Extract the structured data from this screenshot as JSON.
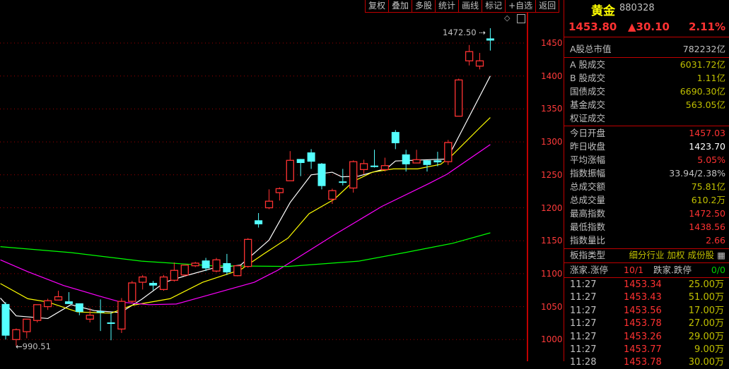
{
  "toolbar": {
    "buttons": [
      "复权",
      "叠加",
      "多股",
      "统计",
      "画线",
      "标记",
      "+自选",
      "返回"
    ]
  },
  "header": {
    "name": "黄金",
    "code": "880328",
    "price": "1453.80",
    "change": "▲30.10",
    "change_pct": "2.11%"
  },
  "market": {
    "label": "A股总市值",
    "value": "782232亿"
  },
  "turnover": [
    {
      "label": "A 股成交",
      "value": "6031.72亿"
    },
    {
      "label": "B 股成交",
      "value": "1.11亿"
    },
    {
      "label": "国债成交",
      "value": "6690.30亿"
    },
    {
      "label": "基金成交",
      "value": "563.05亿"
    },
    {
      "label": "权证成交",
      "value": ""
    }
  ],
  "stats": [
    {
      "label": "今日开盘",
      "value": "1457.03",
      "color": "red"
    },
    {
      "label": "昨日收盘",
      "value": "1423.70",
      "color": "wht"
    },
    {
      "label": "平均涨幅",
      "value": "5.05%",
      "color": "red"
    },
    {
      "label": "指数振幅",
      "value": "33.94/2.38%",
      "color": "gry"
    },
    {
      "label": "总成交额",
      "value": "75.81亿",
      "color": "yel"
    },
    {
      "label": "总成交量",
      "value": "610.2万",
      "color": "yel"
    },
    {
      "label": "最高指数",
      "value": "1472.50",
      "color": "red"
    },
    {
      "label": "最低指数",
      "value": "1438.56",
      "color": "red"
    },
    {
      "label": "指数量比",
      "value": "2.66",
      "color": "red"
    }
  ],
  "board_type": {
    "label": "板指类型",
    "value": "细分行业 加权 成份股"
  },
  "updown": {
    "up_label": "涨家.涨停",
    "up_value": "10/1",
    "down_label": "跌家.跌停",
    "down_value": "0/0"
  },
  "ticks": [
    {
      "time": "11:27",
      "price": "1453.34",
      "vol": "25.00万"
    },
    {
      "time": "11:27",
      "price": "1453.43",
      "vol": "51.00万"
    },
    {
      "time": "11:27",
      "price": "1453.56",
      "vol": "17.00万"
    },
    {
      "time": "11:27",
      "price": "1453.78",
      "vol": "27.00万"
    },
    {
      "time": "11:27",
      "price": "1453.26",
      "vol": "29.00万"
    },
    {
      "time": "11:27",
      "price": "1453.77",
      "vol": "9.00万"
    },
    {
      "time": "11:28",
      "price": "1453.78",
      "vol": "30.00万"
    }
  ],
  "axis_labels": [
    "1450",
    "1400",
    "1350",
    "1300",
    "1250",
    "1200",
    "1150",
    "1100",
    "1050",
    "1000"
  ],
  "annotations": {
    "high": "1472.50",
    "low": "990.51"
  },
  "colors": {
    "up": "#ff3232",
    "down": "#54ffff",
    "ma5": "#ffffff",
    "ma10": "#ffff00",
    "ma20": "#ff00ff",
    "ma60": "#00ff00",
    "grid": "#a00000"
  },
  "chart_data": {
    "type": "candlestick",
    "ylim": [
      1000,
      1450
    ],
    "y_ticks": [
      1000,
      1050,
      1100,
      1150,
      1200,
      1250,
      1300,
      1350,
      1400,
      1450
    ],
    "ohlc": [
      [
        1054,
        1057,
        1000,
        1006
      ],
      [
        1000,
        1017,
        990.51,
        1015
      ],
      [
        1012,
        1031,
        1002,
        1031
      ],
      [
        1029,
        1053,
        1026,
        1053
      ],
      [
        1050,
        1062,
        1045,
        1059
      ],
      [
        1060,
        1074,
        1060,
        1065
      ],
      [
        1058,
        1072,
        1054,
        1054
      ],
      [
        1055,
        1055,
        1037,
        1042
      ],
      [
        1031,
        1048,
        1026,
        1037
      ],
      [
        1043,
        1061,
        1013,
        1042
      ],
      [
        1026,
        1041,
        999,
        1025
      ],
      [
        1016,
        1063,
        1010,
        1058
      ],
      [
        1058,
        1089,
        1055,
        1086
      ],
      [
        1087,
        1098,
        1076,
        1095
      ],
      [
        1086,
        1089,
        1075,
        1082
      ],
      [
        1076,
        1098,
        1074,
        1095
      ],
      [
        1090,
        1117,
        1088,
        1105
      ],
      [
        1098,
        1113,
        1096,
        1113
      ],
      [
        1112,
        1118,
        1110,
        1116
      ],
      [
        1120,
        1124,
        1104,
        1108
      ],
      [
        1104,
        1124,
        1102,
        1121
      ],
      [
        1116,
        1130,
        1098,
        1102
      ],
      [
        1097,
        1112,
        1096,
        1112
      ],
      [
        1111,
        1154,
        1109,
        1152
      ],
      [
        1181,
        1192,
        1170,
        1175
      ],
      [
        1200,
        1228,
        1198,
        1210
      ],
      [
        1223,
        1231,
        1211,
        1229
      ],
      [
        1241,
        1286,
        1241,
        1272
      ],
      [
        1274,
        1274,
        1248,
        1268
      ],
      [
        1284,
        1289,
        1259,
        1270
      ],
      [
        1267,
        1268,
        1228,
        1233
      ],
      [
        1213,
        1229,
        1206,
        1226
      ],
      [
        1240,
        1259,
        1234,
        1239
      ],
      [
        1230,
        1272,
        1223,
        1270
      ],
      [
        1258,
        1273,
        1251,
        1267
      ],
      [
        1264,
        1288,
        1261,
        1263
      ],
      [
        1258,
        1276,
        1255,
        1264
      ],
      [
        1315,
        1318,
        1289,
        1298
      ],
      [
        1281,
        1288,
        1255,
        1266
      ],
      [
        1268,
        1288,
        1268,
        1273
      ],
      [
        1272,
        1272,
        1255,
        1265
      ],
      [
        1272,
        1285,
        1263,
        1269
      ],
      [
        1270,
        1303,
        1265,
        1299
      ],
      [
        1339,
        1396,
        1339,
        1394
      ],
      [
        1423,
        1447,
        1416,
        1437
      ],
      [
        1415,
        1435,
        1410,
        1423
      ],
      [
        1457.03,
        1472.5,
        1438.56,
        1453.8
      ]
    ],
    "ma": [
      {
        "name": "MA5",
        "color": "#ffffff",
        "points": [
          [
            -0.5,
            1063
          ],
          [
            1,
            1036
          ],
          [
            4,
            1032
          ],
          [
            6.2,
            1053
          ],
          [
            8.4,
            1044
          ],
          [
            10.9,
            1041
          ],
          [
            12.9,
            1061
          ],
          [
            15.1,
            1087
          ],
          [
            16.9,
            1096
          ],
          [
            19.6,
            1108
          ],
          [
            22.3,
            1113
          ],
          [
            25,
            1151
          ],
          [
            27,
            1208
          ],
          [
            29,
            1250
          ],
          [
            31,
            1254
          ],
          [
            31.9,
            1247
          ],
          [
            33.5,
            1248
          ],
          [
            36.2,
            1260
          ],
          [
            37,
            1271
          ],
          [
            40.2,
            1273
          ],
          [
            41.9,
            1274
          ],
          [
            43.3,
            1317
          ],
          [
            46,
            1400
          ]
        ]
      },
      {
        "name": "MA10",
        "color": "#ffff00",
        "points": [
          [
            -0.5,
            1085
          ],
          [
            2.1,
            1062
          ],
          [
            4,
            1057
          ],
          [
            6.8,
            1042
          ],
          [
            10,
            1040
          ],
          [
            12,
            1052
          ],
          [
            15.6,
            1062
          ],
          [
            18.7,
            1087
          ],
          [
            22.3,
            1106
          ],
          [
            24.5,
            1130
          ],
          [
            26.8,
            1154
          ],
          [
            28.8,
            1191
          ],
          [
            31.2,
            1213
          ],
          [
            33,
            1240
          ],
          [
            34.8,
            1254
          ],
          [
            36.8,
            1259
          ],
          [
            39.1,
            1259
          ],
          [
            41.3,
            1266
          ],
          [
            42.4,
            1280
          ],
          [
            45.1,
            1323
          ],
          [
            46,
            1337
          ]
        ]
      },
      {
        "name": "MA20",
        "color": "#ff00ff",
        "points": [
          [
            -0.5,
            1121
          ],
          [
            2.1,
            1103
          ],
          [
            5.5,
            1082
          ],
          [
            8.9,
            1066
          ],
          [
            10.9,
            1057
          ],
          [
            13.6,
            1053
          ],
          [
            16.2,
            1054
          ],
          [
            18.9,
            1066
          ],
          [
            23.6,
            1087
          ],
          [
            25.8,
            1105
          ],
          [
            29,
            1137
          ],
          [
            31.2,
            1159
          ],
          [
            35.7,
            1202
          ],
          [
            40.2,
            1237
          ],
          [
            41.9,
            1251
          ],
          [
            46,
            1296
          ]
        ]
      },
      {
        "name": "MA60",
        "color": "#00ff00",
        "points": [
          [
            -0.5,
            1141
          ],
          [
            6.2,
            1132
          ],
          [
            12.9,
            1119
          ],
          [
            19.6,
            1112
          ],
          [
            26.8,
            1111
          ],
          [
            33.5,
            1119
          ],
          [
            37.9,
            1132
          ],
          [
            42.4,
            1146
          ],
          [
            46,
            1162
          ]
        ]
      }
    ]
  }
}
